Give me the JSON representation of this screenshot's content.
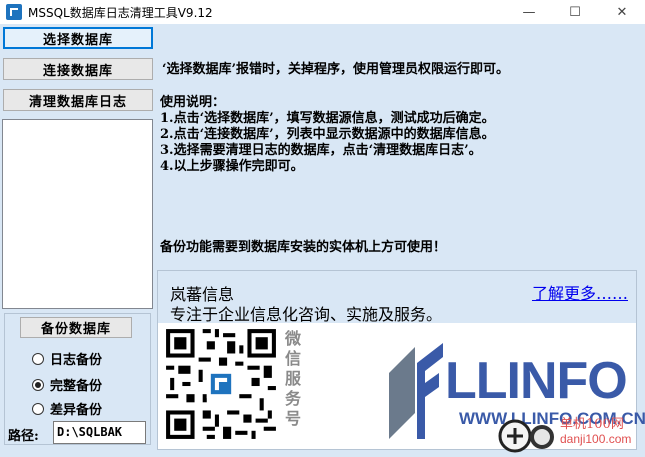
{
  "window": {
    "title": "MSSQL数据库日志清理工具V9.12",
    "controls": {
      "minimize": "—",
      "maximize": "☐",
      "close": "✕"
    }
  },
  "sidebar": {
    "select_db_button": "选择数据库",
    "connect_db_button": "连接数据库",
    "clean_log_button": "清理数据库日志",
    "database_list": []
  },
  "backup": {
    "button": "备份数据库",
    "options": [
      {
        "label": "日志备份",
        "selected": false
      },
      {
        "label": "完整备份",
        "selected": true
      },
      {
        "label": "差异备份",
        "selected": false
      }
    ],
    "path_label": "路径:",
    "path_value": "D:\\SQLBAK"
  },
  "notes": {
    "error_tip": "‘选择数据库’报错时，关掉程序，使用管理员权限运行即可。",
    "usage_title": "使用说明：",
    "steps": [
      "1.点击‘选择数据库’，填写数据源信息，测试成功后确定。",
      "2.点击‘连接数据库’，列表中显示数据源中的数据库信息。",
      "3.选择需要清理日志的数据库，点击‘清理数据库日志’。",
      "4.以上步骤操作完即可。"
    ],
    "backup_tip": "备份功能需要到数据库安装的实体机上方可使用！"
  },
  "company": {
    "name": "岚蕃信息",
    "link": "了解更多……",
    "slogan": "专注于企业信息化咨询、实施及服务。",
    "wechat_label": "微信服务号",
    "logo_text": "LLINFO",
    "logo_url": "WWW.LLINFO.COM.CN",
    "brand_color": "#3a5aa8"
  },
  "watermark": {
    "text_top": "单机100网",
    "text_bottom": "danji100.com"
  }
}
